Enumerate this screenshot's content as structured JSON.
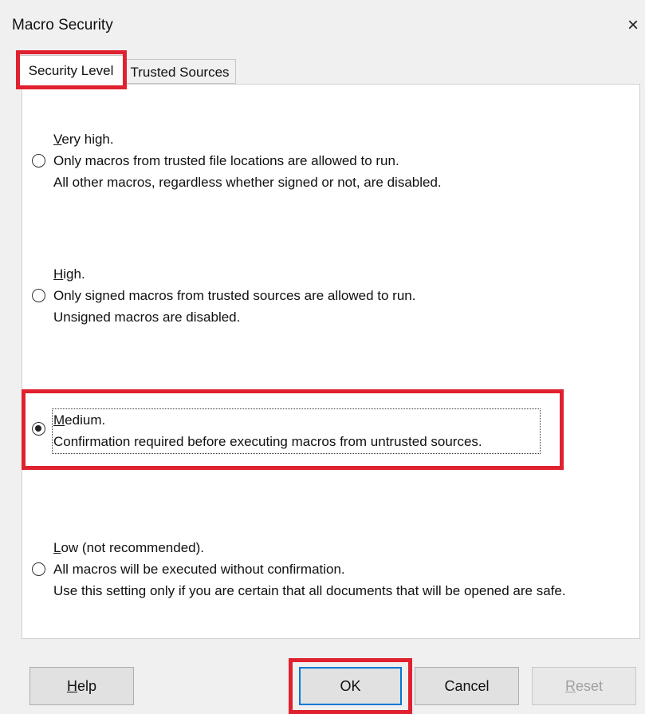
{
  "dialog": {
    "title": "Macro Security",
    "close_glyph": "×",
    "close_icon": "close-icon"
  },
  "tabs": [
    {
      "label": "Security Level",
      "selected": true
    },
    {
      "label": "Trusted Sources",
      "selected": false
    }
  ],
  "options": [
    {
      "key": "V",
      "label_rest": "ery high.",
      "lines": [
        "Only macros from trusted file locations are allowed to run.",
        "All other macros, regardless whether signed or not, are disabled."
      ],
      "checked": false
    },
    {
      "key": "H",
      "label_rest": "igh.",
      "lines": [
        "Only signed macros from trusted sources are allowed to run.",
        "Unsigned macros are disabled."
      ],
      "checked": false
    },
    {
      "key": "M",
      "label_rest": "edium.",
      "lines": [
        "Confirmation required before executing macros from untrusted sources."
      ],
      "checked": true
    },
    {
      "key": "L",
      "label_rest": "ow (not recommended).",
      "lines": [
        "All macros will be executed without confirmation.",
        "Use this setting only if you are certain that all documents that will be opened are safe."
      ],
      "checked": false
    }
  ],
  "buttons": {
    "help": {
      "key": "H",
      "rest": "elp"
    },
    "ok": {
      "label": "OK"
    },
    "cancel": {
      "label": "Cancel"
    },
    "reset": {
      "key": "R",
      "rest": "eset",
      "enabled": false
    }
  },
  "colors": {
    "highlight": "#e0212f",
    "accent": "#0078d7",
    "panel_bg": "#ffffff",
    "window_bg": "#f0f0f0"
  }
}
